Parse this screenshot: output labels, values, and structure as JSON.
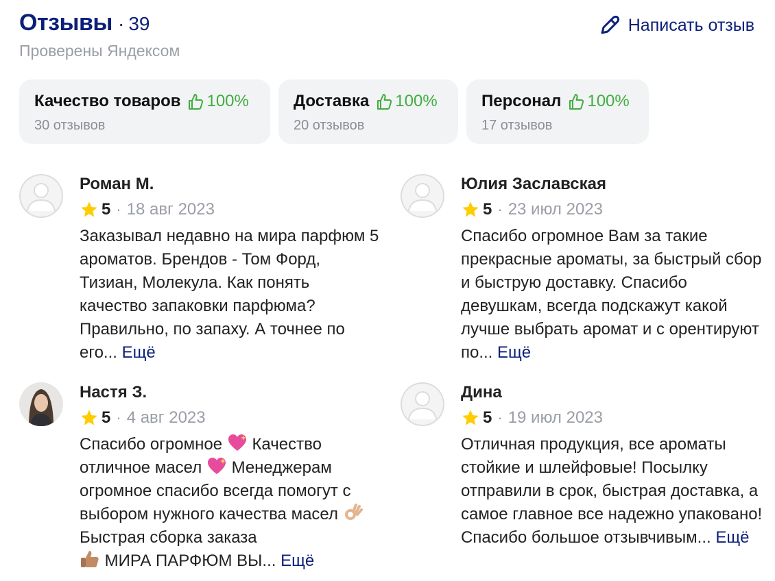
{
  "header": {
    "title": "Отзывы",
    "separator": "·",
    "count": "39",
    "subtitle": "Проверены Яндексом"
  },
  "write_review": {
    "label": "Написать отзыв",
    "icon": "pencil-icon"
  },
  "categories": [
    {
      "name": "Качество товаров",
      "percent": "100%",
      "reviews": "30 отзывов",
      "icon": "thumbs-up-icon"
    },
    {
      "name": "Доставка",
      "percent": "100%",
      "reviews": "20 отзывов",
      "icon": "thumbs-up-icon"
    },
    {
      "name": "Персонал",
      "percent": "100%",
      "reviews": "17 отзывов",
      "icon": "thumbs-up-icon"
    }
  ],
  "colors": {
    "accent": "#0a1f7a",
    "positive": "#3fae3f",
    "muted": "#9a9ea6",
    "chip_bg": "#f2f3f5",
    "star": "#ffcc00"
  },
  "more_label": "Ещё",
  "dot": "·",
  "reviews": [
    {
      "name": "Роман М.",
      "rating": "5",
      "date": "18 авг 2023",
      "text": "Заказывал недавно на мира парфюм 5 ароматов. Брендов - Том Форд, Тизиан, Молекула. Как понять качество запаковки парфюма? Правильно, по запаху. А точнее по его..."
    },
    {
      "name": "Юлия Заславская",
      "rating": "5",
      "date": "23 июл 2023",
      "text": "Спасибо огромное Вам за такие прекрасные ароматы, за быстрый сбор и быструю доставку. Спасибо девушкам, всегда подскажут какой лучше выбрать аромат и с орентируют по..."
    },
    {
      "name": "Настя З.",
      "rating": "5",
      "date": "4 авг 2023",
      "text_parts": [
        "Спасибо огромное",
        "Качество отличное масел",
        "Менеджерам огромное спасибо всегда помогут с выбором нужного качества масел",
        "Быстрая сборка заказа",
        "МИРА ПАРФЮМ ВЫ..."
      ]
    },
    {
      "name": "Дина",
      "rating": "5",
      "date": "19 июл 2023",
      "text": "Отличная продукция, все ароматы стойкие и шлейфовые! Посылку отправили в срок, быстрая доставка, а самое главное все надежно упаковано! Спасибо большое отзывчивым..."
    }
  ]
}
